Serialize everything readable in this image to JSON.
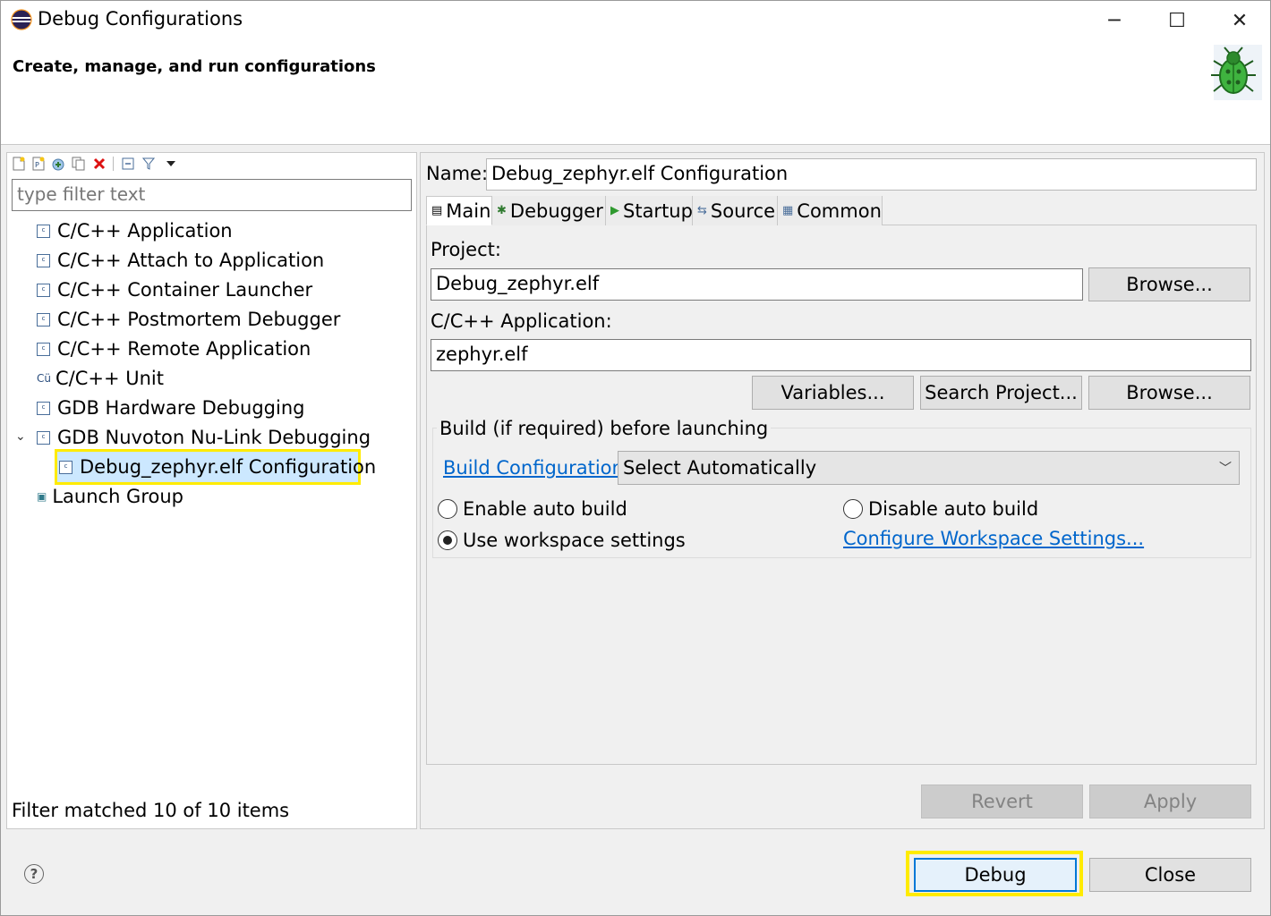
{
  "window": {
    "title": "Debug Configurations",
    "minimize_glyph": "─",
    "maximize_glyph": "☐",
    "close_glyph": "✕"
  },
  "header": {
    "title": "Create, manage, and run configurations",
    "banner_icon": "bug-icon"
  },
  "left": {
    "toolbar_icons": [
      "new-config-icon",
      "new-prototype-icon",
      "export-icon",
      "duplicate-icon",
      "delete-icon",
      "collapse-all-icon",
      "filter-icon",
      "view-menu-icon"
    ],
    "filter_placeholder": "type filter text",
    "tree": [
      {
        "label": "C/C++ Application",
        "icon": "c-config-icon"
      },
      {
        "label": "C/C++ Attach to Application",
        "icon": "c-config-icon"
      },
      {
        "label": "C/C++ Container Launcher",
        "icon": "c-config-icon"
      },
      {
        "label": "C/C++ Postmortem Debugger",
        "icon": "c-config-icon"
      },
      {
        "label": "C/C++ Remote Application",
        "icon": "c-config-icon"
      },
      {
        "label": "C/C++ Unit",
        "icon": "cunit-icon"
      },
      {
        "label": "GDB Hardware Debugging",
        "icon": "c-config-icon"
      },
      {
        "label": "GDB Nuvoton Nu-Link Debugging",
        "icon": "c-config-icon",
        "expanded": true
      },
      {
        "label": "Debug_zephyr.elf Configuration",
        "icon": "c-config-icon",
        "selected": true
      },
      {
        "label": "Launch Group",
        "icon": "launch-group-icon"
      }
    ],
    "status": "Filter matched 10 of 10 items"
  },
  "right": {
    "name_label": "Name:",
    "name_value": "Debug_zephyr.elf Configuration",
    "tabs": [
      {
        "label": "Main",
        "icon": "main-tab-icon",
        "active": true
      },
      {
        "label": "Debugger",
        "icon": "debugger-tab-icon"
      },
      {
        "label": "Startup",
        "icon": "startup-tab-icon"
      },
      {
        "label": "Source",
        "icon": "source-tab-icon"
      },
      {
        "label": "Common",
        "icon": "common-tab-icon"
      }
    ],
    "project_label": "Project:",
    "project_value": "Debug_zephyr.elf",
    "browse_label": "Browse...",
    "app_label": "C/C++ Application:",
    "app_value": "zephyr.elf",
    "variables_label": "Variables...",
    "search_project_label": "Search Project...",
    "browse2_label": "Browse...",
    "build_group_title": "Build (if required) before launching",
    "build_config_link": "Build Configuration:",
    "build_config_value": "Select Automatically",
    "enable_auto_build": "Enable auto build",
    "disable_auto_build": "Disable auto build",
    "use_workspace": "Use workspace settings",
    "configure_workspace_link": "Configure Workspace Settings...",
    "selected_radio": "use_workspace",
    "revert_label": "Revert",
    "apply_label": "Apply"
  },
  "footer": {
    "help_icon": "help-icon",
    "debug_label": "Debug",
    "close_label": "Close"
  },
  "colors": {
    "highlight": "#ffeb00",
    "link": "#0066cc",
    "selection": "#cce8ff"
  }
}
